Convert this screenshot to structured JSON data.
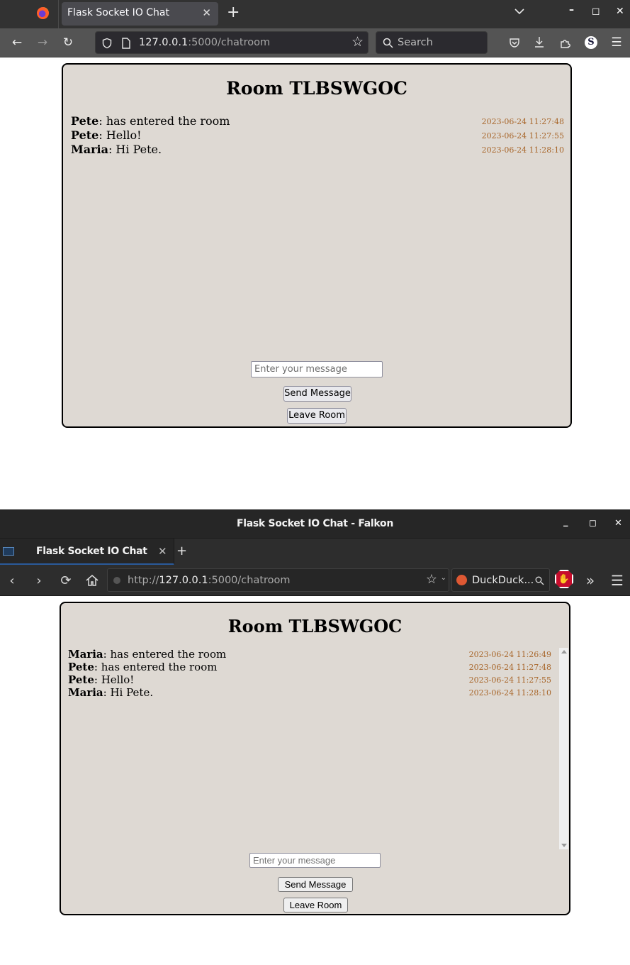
{
  "firefox": {
    "tab_title": "Flask Socket IO Chat",
    "url_host": "127.0.0.1",
    "url_rest": ":5000/chatroom",
    "search_placeholder": "Search",
    "page": {
      "room_title": "Room TLBSWGOC",
      "messages": [
        {
          "user": "Pete",
          "text": ": has entered the room",
          "time": "2023-06-24 11:27:48"
        },
        {
          "user": "Pete",
          "text": ": Hello!",
          "time": "2023-06-24 11:27:55"
        },
        {
          "user": "Maria",
          "text": ": Hi Pete.",
          "time": "2023-06-24 11:28:10"
        }
      ],
      "input_placeholder": "Enter your message",
      "input_value": "",
      "send_label": "Send Message",
      "leave_label": "Leave Room"
    }
  },
  "falkon": {
    "window_title": "Flask Socket IO Chat - Falkon",
    "tab_title": "Flask Socket IO Chat",
    "url_scheme": "http://",
    "url_host": "127.0.0.1",
    "url_rest": ":5000/chatroom",
    "search_engine": "DuckDuck...",
    "page": {
      "room_title": "Room TLBSWGOC",
      "messages": [
        {
          "user": "Maria",
          "text": ": has entered the room",
          "time": "2023-06-24 11:26:49"
        },
        {
          "user": "Pete",
          "text": ": has entered the room",
          "time": "2023-06-24 11:27:48"
        },
        {
          "user": "Pete",
          "text": ": Hello!",
          "time": "2023-06-24 11:27:55"
        },
        {
          "user": "Maria",
          "text": ": Hi Pete.",
          "time": "2023-06-24 11:28:10"
        }
      ],
      "input_placeholder": "Enter your message",
      "input_value": "",
      "send_label": "Send Message",
      "leave_label": "Leave Room"
    }
  },
  "colors": {
    "chat_bg": "#ded9d3",
    "timestamp": "#a8662a",
    "falkon_tab_accent": "#2a5a9a"
  }
}
